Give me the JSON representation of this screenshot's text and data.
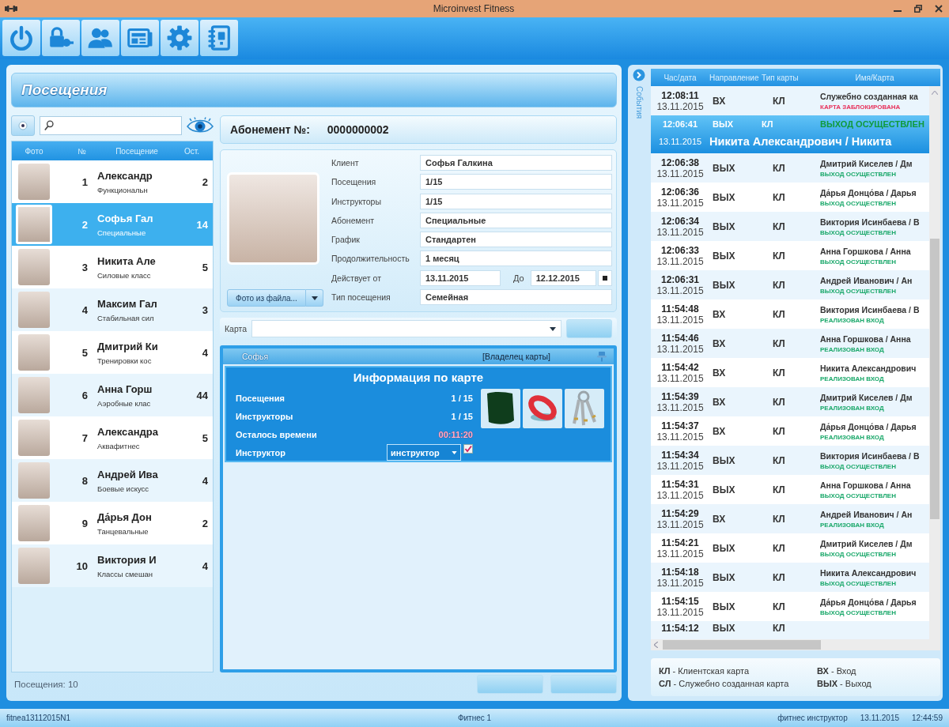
{
  "window": {
    "title": "Microinvest Fitness"
  },
  "visits": {
    "title": "Посещения",
    "clients": {
      "columns": [
        "Фото",
        "№",
        "Посещение",
        "Ост."
      ],
      "rows": [
        {
          "number": "1",
          "name": "Александр",
          "program": "Функциональн",
          "remaining": "2",
          "selected": false
        },
        {
          "number": "2",
          "name": "Софья Гал",
          "program": "Специальные",
          "remaining": "14",
          "selected": true
        },
        {
          "number": "3",
          "name": "Никита Але",
          "program": "Силовые класс",
          "remaining": "5",
          "selected": false
        },
        {
          "number": "4",
          "name": "Максим Гал",
          "program": "Стабильная сил",
          "remaining": "3",
          "selected": false
        },
        {
          "number": "5",
          "name": "Дмитрий Ки",
          "program": "Тренировки кос",
          "remaining": "4",
          "selected": false
        },
        {
          "number": "6",
          "name": "Анна Горш",
          "program": "Аэробные клас",
          "remaining": "44",
          "selected": false
        },
        {
          "number": "7",
          "name": "Александра",
          "program": "Аквафитнес",
          "remaining": "5",
          "selected": false
        },
        {
          "number": "8",
          "name": "Андрей Ива",
          "program": "Боевые искусс",
          "remaining": "4",
          "selected": false
        },
        {
          "number": "9",
          "name": "Да́рья Дон",
          "program": "Танцевальные",
          "remaining": "2",
          "selected": false
        },
        {
          "number": "10",
          "name": "Виктория И",
          "program": "Классы смешан",
          "remaining": "4",
          "selected": false
        }
      ]
    },
    "count": "Посещения: 10",
    "buttons": [
      {
        "disabled": true
      },
      {
        "disabled": true
      }
    ]
  },
  "subscription": {
    "label": "Абонемент №:",
    "number": "0000000002",
    "photo_button": "Фото из файла...",
    "fields": [
      {
        "kind": "text",
        "label": "Клиент",
        "value": "Софья Галкина"
      },
      {
        "kind": "text",
        "label": "Посещения",
        "value": "1/15"
      },
      {
        "kind": "text",
        "label": "Инструкторы",
        "value": "1/15"
      },
      {
        "kind": "text",
        "label": "Абонемент",
        "value": "Специальные"
      },
      {
        "kind": "text",
        "label": "График",
        "value": "Стандартен"
      },
      {
        "kind": "text",
        "label": "Продолжительность",
        "value": "1 месяц"
      },
      {
        "kind": "range",
        "label": "Действует от",
        "value": "13.11.2015",
        "to_label": "До",
        "to_value": "12.12.2015"
      },
      {
        "kind": "text",
        "label": "Тип посещения",
        "value": "Семейная"
      }
    ]
  },
  "card": {
    "label": "Карта",
    "button": {
      "disabled": true
    }
  },
  "card_owner": {
    "name": "Софья",
    "role": "[Владелец карты]"
  },
  "card_info": {
    "title": "Информация по карте",
    "rows": [
      {
        "kind": "count",
        "label": "Посещения",
        "value": "1 / 15"
      },
      {
        "kind": "count",
        "label": "Инструкторы",
        "value": "1 / 15"
      },
      {
        "kind": "timer",
        "label": "Осталось времени",
        "value": "00:11:20"
      }
    ],
    "instructor": {
      "label": "Инструктор",
      "value": "инструктор",
      "checked": true
    }
  },
  "events": {
    "side_label": "События",
    "columns": [
      "Час/дата",
      "Направление",
      "Тип карты",
      "Имя/Карта"
    ],
    "rows": [
      {
        "time": "12:08:11",
        "date": "13.11.2015",
        "direction": "ВХ",
        "card_type": "КЛ",
        "name": "Служебно созданная ка",
        "status": "КАРТА ЗАБЛОКИРОВАНА",
        "color": "#e8305a",
        "selected": false
      },
      {
        "time": "12:06:41",
        "date": "13.11.2015",
        "direction": "ВЫХ",
        "card_type": "КЛ",
        "name": "Никита Александрович / Никита",
        "status": "ВЫХОД ОСУЩЕСТВЛЕН",
        "color": "#109a3c",
        "selected": true
      },
      {
        "time": "12:06:38",
        "date": "13.11.2015",
        "direction": "ВЫХ",
        "card_type": "КЛ",
        "name": "Дмитрий Киселев / Дм",
        "status": "ВЫХОД ОСУЩЕСТВЛЕН",
        "color": "#1aa86a",
        "selected": false
      },
      {
        "time": "12:06:36",
        "date": "13.11.2015",
        "direction": "ВЫХ",
        "card_type": "КЛ",
        "name": "Да́рья Донцо́ва / Дарья",
        "status": "ВЫХОД ОСУЩЕСТВЛЕН",
        "color": "#1aa86a",
        "selected": false
      },
      {
        "time": "12:06:34",
        "date": "13.11.2015",
        "direction": "ВЫХ",
        "card_type": "КЛ",
        "name": "Виктория Исинбаева / В",
        "status": "ВЫХОД ОСУЩЕСТВЛЕН",
        "color": "#1aa86a",
        "selected": false
      },
      {
        "time": "12:06:33",
        "date": "13.11.2015",
        "direction": "ВЫХ",
        "card_type": "КЛ",
        "name": "Анна Горшкова / Анна",
        "status": "ВЫХОД ОСУЩЕСТВЛЕН",
        "color": "#1aa86a",
        "selected": false
      },
      {
        "time": "12:06:31",
        "date": "13.11.2015",
        "direction": "ВЫХ",
        "card_type": "КЛ",
        "name": "Андрей Иванович / Ан",
        "status": "ВЫХОД ОСУЩЕСТВЛЕН",
        "color": "#1aa86a",
        "selected": false
      },
      {
        "time": "11:54:48",
        "date": "13.11.2015",
        "direction": "ВХ",
        "card_type": "КЛ",
        "name": "Виктория Исинбаева / В",
        "status": "РЕАЛИЗОВАН ВХОД",
        "color": "#1aa86a",
        "selected": false
      },
      {
        "time": "11:54:46",
        "date": "13.11.2015",
        "direction": "ВХ",
        "card_type": "КЛ",
        "name": "Анна Горшкова / Анна",
        "status": "РЕАЛИЗОВАН ВХОД",
        "color": "#1aa86a",
        "selected": false
      },
      {
        "time": "11:54:42",
        "date": "13.11.2015",
        "direction": "ВХ",
        "card_type": "КЛ",
        "name": "Никита Александрович",
        "status": "РЕАЛИЗОВАН ВХОД",
        "color": "#1aa86a",
        "selected": false
      },
      {
        "time": "11:54:39",
        "date": "13.11.2015",
        "direction": "ВХ",
        "card_type": "КЛ",
        "name": "Дмитрий Киселев / Дм",
        "status": "РЕАЛИЗОВАН ВХОД",
        "color": "#1aa86a",
        "selected": false
      },
      {
        "time": "11:54:37",
        "date": "13.11.2015",
        "direction": "ВХ",
        "card_type": "КЛ",
        "name": "Да́рья Донцо́ва / Дарья",
        "status": "РЕАЛИЗОВАН ВХОД",
        "color": "#1aa86a",
        "selected": false
      },
      {
        "time": "11:54:34",
        "date": "13.11.2015",
        "direction": "ВЫХ",
        "card_type": "КЛ",
        "name": "Виктория Исинбаева / В",
        "status": "ВЫХОД ОСУЩЕСТВЛЕН",
        "color": "#1aa86a",
        "selected": false
      },
      {
        "time": "11:54:31",
        "date": "13.11.2015",
        "direction": "ВЫХ",
        "card_type": "КЛ",
        "name": "Анна Горшкова / Анна",
        "status": "ВЫХОД ОСУЩЕСТВЛЕН",
        "color": "#1aa86a",
        "selected": false
      },
      {
        "time": "11:54:29",
        "date": "13.11.2015",
        "direction": "ВХ",
        "card_type": "КЛ",
        "name": "Андрей Иванович / Ан",
        "status": "РЕАЛИЗОВАН ВХОД",
        "color": "#1aa86a",
        "selected": false
      },
      {
        "time": "11:54:21",
        "date": "13.11.2015",
        "direction": "ВЫХ",
        "card_type": "КЛ",
        "name": "Дмитрий Киселев / Дм",
        "status": "ВЫХОД ОСУЩЕСТВЛЕН",
        "color": "#1aa86a",
        "selected": false
      },
      {
        "time": "11:54:18",
        "date": "13.11.2015",
        "direction": "ВЫХ",
        "card_type": "КЛ",
        "name": "Никита Александрович",
        "status": "ВЫХОД ОСУЩЕСТВЛЕН",
        "color": "#1aa86a",
        "selected": false
      },
      {
        "time": "11:54:15",
        "date": "13.11.2015",
        "direction": "ВЫХ",
        "card_type": "КЛ",
        "name": "Да́рья Донцо́ва / Дарья",
        "status": "ВЫХОД ОСУЩЕСТВЛЕН",
        "color": "#1aa86a",
        "selected": false
      },
      {
        "time": "11:54:12",
        "direction": "ВЫХ",
        "card_type": "КЛ",
        "selected": false
      }
    ],
    "legend": [
      "**КЛ** - Клиентская карта",
      "**ВХ** - Вход",
      "**СЛ** - Служебно созданная карта",
      "**ВЫХ** - Выход"
    ]
  },
  "status_bar": {
    "left": "fitnea13112015N1",
    "center": "Фитнес 1",
    "user": "фитнес инструктор",
    "date": "13.11.2015",
    "time": "12:44:59"
  }
}
